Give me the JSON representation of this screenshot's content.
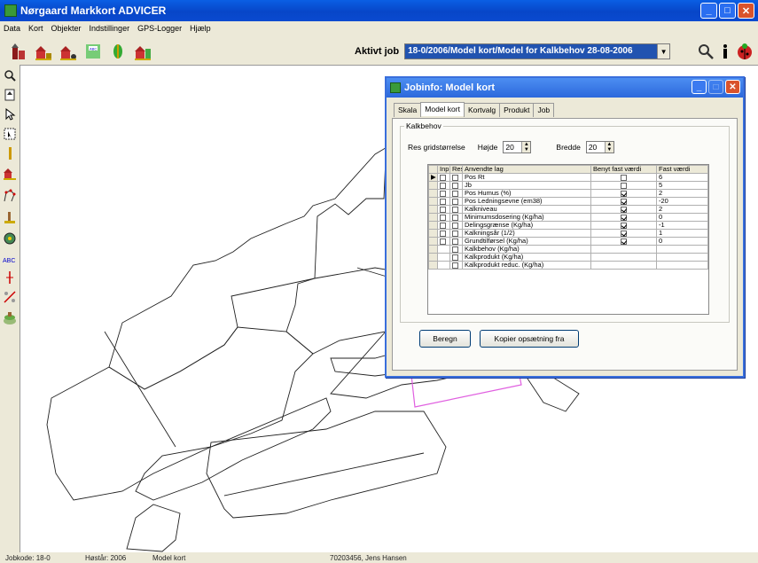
{
  "app": {
    "title": "Nørgaard Markkort ADVICER"
  },
  "menu": [
    "Data",
    "Kort",
    "Objekter",
    "Indstillinger",
    "GPS-Logger",
    "Hjælp"
  ],
  "toolbar": {
    "job_label": "Aktivt job",
    "job_value": "18-0/2006/Model kort/Model for Kalkbehov 28-08-2006"
  },
  "dialog": {
    "title": "Jobinfo: Model kort",
    "tabs": [
      "Skala",
      "Model kort",
      "Kortvalg",
      "Produkt",
      "Job"
    ],
    "active_tab": "Model kort",
    "group_label": "Kalkbehov",
    "grid_size_label": "Res gridstørrelse",
    "height_label": "Højde",
    "height_value": "20",
    "width_label": "Bredde",
    "width_value": "20",
    "columns": [
      "Inp",
      "Res",
      "Anvendte lag",
      "Benyt fast værdi",
      "Fast værdi"
    ],
    "rows": [
      {
        "inp": true,
        "res": true,
        "name": "Pos Rt",
        "use_fixed": false,
        "fixed": "6"
      },
      {
        "inp": true,
        "res": true,
        "name": "Jb",
        "use_fixed": false,
        "fixed": "5"
      },
      {
        "inp": true,
        "res": true,
        "name": "Pos Humus (%)",
        "use_fixed": true,
        "fixed": "2"
      },
      {
        "inp": true,
        "res": true,
        "name": "Pos Ledningsevne (em38)",
        "use_fixed": true,
        "fixed": "-20"
      },
      {
        "inp": true,
        "res": true,
        "name": "Kalkniveau",
        "use_fixed": true,
        "fixed": "2"
      },
      {
        "inp": true,
        "res": true,
        "name": "Minimumsdosering (Kg/ha)",
        "use_fixed": true,
        "fixed": "0"
      },
      {
        "inp": true,
        "res": true,
        "name": "Delingsgrænse (Kg/ha)",
        "use_fixed": true,
        "fixed": "-1"
      },
      {
        "inp": true,
        "res": true,
        "name": "Kalkningsår (1/2)",
        "use_fixed": true,
        "fixed": "1"
      },
      {
        "inp": true,
        "res": true,
        "name": "Grundtilførsel (Kg/ha)",
        "use_fixed": true,
        "fixed": "0"
      },
      {
        "inp": false,
        "res": true,
        "name": "Kalkbehov (Kg/ha)",
        "use_fixed": null,
        "fixed": ""
      },
      {
        "inp": false,
        "res": true,
        "name": "Kalkprodukt (Kg/ha)",
        "use_fixed": null,
        "fixed": ""
      },
      {
        "inp": false,
        "res": true,
        "name": "Kalkprodukt reduc. (Kg/ha)",
        "use_fixed": null,
        "fixed": ""
      }
    ],
    "calc_button": "Beregn",
    "copy_button": "Kopier opsætning fra"
  },
  "status": [
    "Jobkode: 18-0",
    "Høstår: 2006",
    "Model kort",
    "70203456, Jens Hansen"
  ],
  "icons": {
    "toolbar": [
      "farm-icon",
      "barn-icon",
      "barn-tractor-icon",
      "map-label-icon",
      "crop-icon",
      "field-map-icon"
    ],
    "toolbar_right": [
      "zoom-icon",
      "info-icon",
      "ladybug-icon"
    ],
    "left": [
      "zoom-icon",
      "pan-icon",
      "select-arrow-icon",
      "select-area-icon",
      "line-icon",
      "barn-small-icon",
      "network-icon",
      "sampling-icon",
      "gear-tractor-icon",
      "text-label-icon",
      "point-icon",
      "split-icon",
      "layers-icon"
    ]
  },
  "colors": {
    "titlebar": "#0a5fe4",
    "selection": "#2153b0",
    "map_highlight": "#e060e0"
  }
}
